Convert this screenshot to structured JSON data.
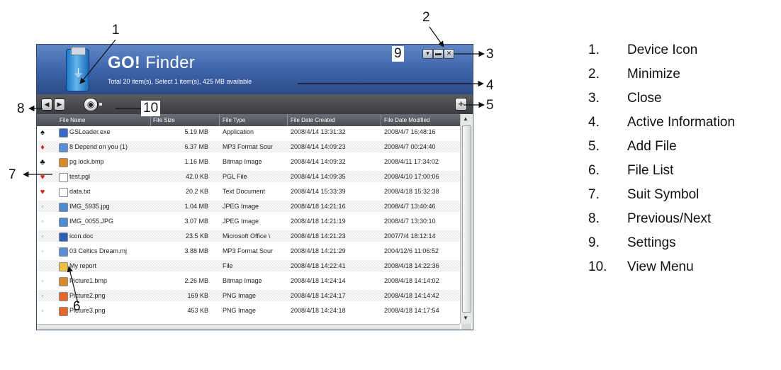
{
  "app": {
    "title_bold": "GO!",
    "title_rest": " Finder",
    "active_info": "Total 20 item(s), Select 1 item(s), 425 MB available",
    "view_menu_value": "1",
    "icons": {
      "device": "usb-drive-icon",
      "prev": "chevron-left-icon",
      "next": "chevron-right-icon",
      "view": "eye-icon",
      "add": "plus-icon",
      "settings": "chevron-down-icon",
      "minimize": "minimize-icon",
      "close": "close-icon"
    }
  },
  "columns": [
    "File Name",
    "File Size",
    "File Type",
    "File Date Created",
    "File Date Modified"
  ],
  "files": [
    {
      "suit": "♠",
      "suit_color": "#111111",
      "name": "GSLoader.exe",
      "size": "5.19 MB",
      "type": "Application",
      "created": "2008/4/14 13:31:32",
      "modified": "2008/4/7 16:48:16",
      "icon_color": "#3a67c8"
    },
    {
      "suit": "♦",
      "suit_color": "#d42020",
      "name": "8 Depend on you (1)",
      "size": "6.37 MB",
      "type": "MP3 Format Sour",
      "created": "2008/4/14 14:09:23",
      "modified": "2008/4/7 00:24:40",
      "icon_color": "#5b8ed8"
    },
    {
      "suit": "♣",
      "suit_color": "#111111",
      "name": "pg lock.bmp",
      "size": "1.16 MB",
      "type": "Bitmap Image",
      "created": "2008/4/14 14:09:32",
      "modified": "2008/4/11 17:34:02",
      "icon_color": "#d88a2a"
    },
    {
      "suit": "♥",
      "suit_color": "#d42020",
      "name": "test.pgl",
      "size": "42.0 KB",
      "type": "PGL File",
      "created": "2008/4/14 14:09:35",
      "modified": "2008/4/10 17:00:06",
      "icon_color": "#ffffff"
    },
    {
      "suit": "♥",
      "suit_color": "#d42020",
      "name": "data.txt",
      "size": "20.2 KB",
      "type": "Text Document",
      "created": "2008/4/14 15:33:39",
      "modified": "2008/4/18 15:32:38",
      "icon_color": "#ffffff"
    },
    {
      "suit": "◦",
      "suit_color": "#999999",
      "name": "IMG_5935.jpg",
      "size": "1.04 MB",
      "type": "JPEG Image",
      "created": "2008/4/18 14:21:16",
      "modified": "2008/4/7 13:40:46",
      "icon_color": "#4a8ccf"
    },
    {
      "suit": "◦",
      "suit_color": "#999999",
      "name": "IMG_0055.JPG",
      "size": "3.07 MB",
      "type": "JPEG Image",
      "created": "2008/4/18 14:21:19",
      "modified": "2008/4/7 13:30:10",
      "icon_color": "#4a8ccf"
    },
    {
      "suit": "◦",
      "suit_color": "#999999",
      "name": "icon.doc",
      "size": "23.5 KB",
      "type": "Microsoft Office \\",
      "created": "2008/4/18 14:21:23",
      "modified": "2007/7/4 18:12:14",
      "icon_color": "#2d5fb5"
    },
    {
      "suit": "◦",
      "suit_color": "#999999",
      "name": "03 Celtics Dream.mj",
      "size": "3.88 MB",
      "type": "MP3 Format Sour",
      "created": "2008/4/18 14:21:29",
      "modified": "2004/12/6 11:06:52",
      "icon_color": "#5b8ed8"
    },
    {
      "suit": "",
      "suit_color": "#999999",
      "name": "My report",
      "size": "",
      "type": "File",
      "created": "2008/4/18 14:22:41",
      "modified": "2008/4/18 14:22:36",
      "icon_color": "#f0c040"
    },
    {
      "suit": "◦",
      "suit_color": "#999999",
      "name": "Picture1.bmp",
      "size": "2.26 MB",
      "type": "Bitmap Image",
      "created": "2008/4/18 14:24:14",
      "modified": "2008/4/18 14:14:02",
      "icon_color": "#d88a2a"
    },
    {
      "suit": "◦",
      "suit_color": "#999999",
      "name": "Picture2.png",
      "size": "169 KB",
      "type": "PNG Image",
      "created": "2008/4/18 14:24:17",
      "modified": "2008/4/18 14:14:42",
      "icon_color": "#e2672a"
    },
    {
      "suit": "◦",
      "suit_color": "#999999",
      "name": "Picture3.png",
      "size": "453 KB",
      "type": "PNG Image",
      "created": "2008/4/18 14:24:18",
      "modified": "2008/4/18 14:17:54",
      "icon_color": "#e2672a"
    }
  ],
  "callouts": [
    "1",
    "2",
    "3",
    "4",
    "5",
    "6",
    "7",
    "8",
    "9",
    "10"
  ],
  "legend": [
    {
      "n": "1.",
      "t": "Device Icon"
    },
    {
      "n": "2.",
      "t": "Minimize"
    },
    {
      "n": "3.",
      "t": "Close"
    },
    {
      "n": "4.",
      "t": "Active Information"
    },
    {
      "n": "5.",
      "t": "Add File"
    },
    {
      "n": "6.",
      "t": "File List"
    },
    {
      "n": "7.",
      "t": "Suit Symbol"
    },
    {
      "n": "8.",
      "t": "Previous/Next"
    },
    {
      "n": "9.",
      "t": "Settings"
    },
    {
      "n": "10.",
      "t": "View Menu"
    }
  ]
}
